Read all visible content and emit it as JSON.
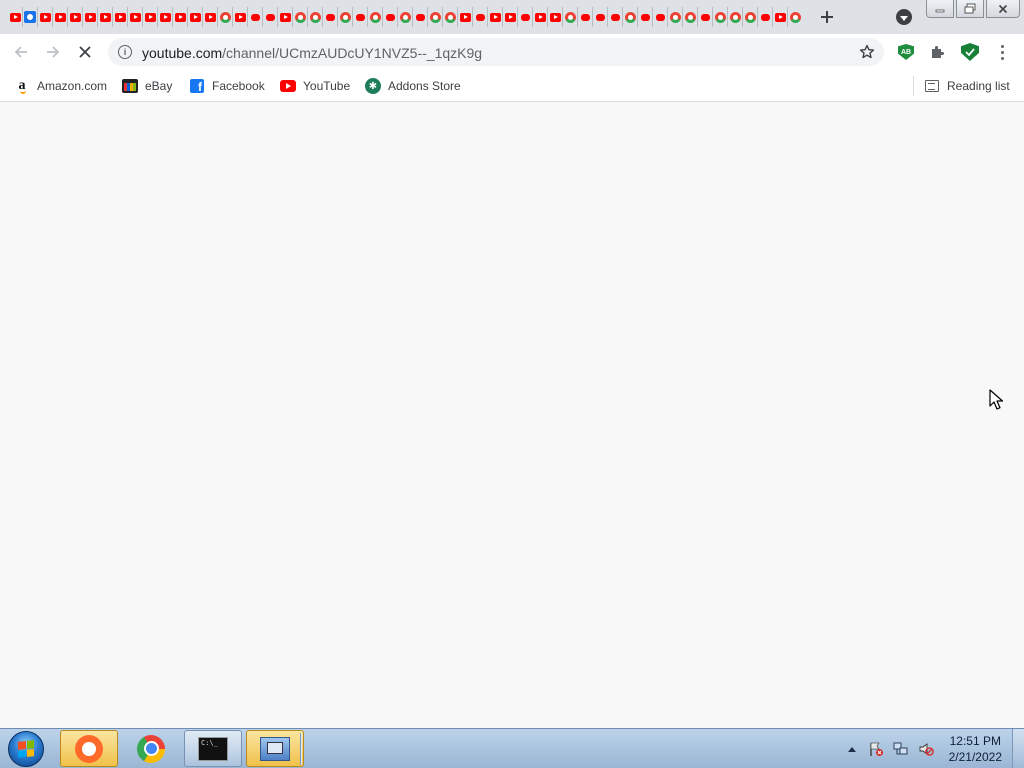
{
  "browser": {
    "tabs": {
      "favicons": [
        "youtube",
        "blue",
        "youtube",
        "youtube",
        "youtube",
        "youtube",
        "youtube",
        "youtube",
        "youtube",
        "youtube",
        "youtube",
        "youtube",
        "youtube",
        "youtube",
        "mixed",
        "youtube",
        "dot",
        "dot",
        "youtube",
        "mixed",
        "mixed",
        "dot",
        "mixed",
        "dot",
        "mixed",
        "dot",
        "mixed",
        "dot",
        "mixed",
        "mixed",
        "youtube",
        "dot",
        "youtube",
        "youtube",
        "dot",
        "youtube",
        "youtube",
        "mixed",
        "dot",
        "dot",
        "dot",
        "mixed",
        "dot",
        "dot",
        "mixed",
        "mixed",
        "dot",
        "mixed",
        "mixed",
        "mixed",
        "dot",
        "youtube",
        "mixed"
      ]
    },
    "new_tab_icon": "plus-icon",
    "address_bar": {
      "host": "youtube.com",
      "path": "/channel/UCmzAUDcUY1NVZ5--_1qzK9g"
    },
    "loading": true
  },
  "bookmarks": [
    {
      "label": "Amazon.com",
      "icon": "amazon-icon"
    },
    {
      "label": "eBay",
      "icon": "ebay-icon"
    },
    {
      "label": "Facebook",
      "icon": "facebook-icon"
    },
    {
      "label": "YouTube",
      "icon": "youtube-icon"
    },
    {
      "label": "Addons Store",
      "icon": "addons-store-icon"
    }
  ],
  "reading_list": {
    "label": "Reading list"
  },
  "taskbar": {
    "apps": [
      {
        "name": "app-clock",
        "state": "active"
      },
      {
        "name": "chrome",
        "state": "plain"
      },
      {
        "name": "command-prompt",
        "state": "open"
      },
      {
        "name": "remote-desktop",
        "state": "active"
      }
    ],
    "cmd_text": "C:\\_",
    "time": "12:51 PM",
    "date": "2/21/2022"
  },
  "colors": {
    "youtube_red": "#ff0000",
    "page_bg": "#f8f8f8",
    "tabstrip_bg": "#dee1e6"
  }
}
